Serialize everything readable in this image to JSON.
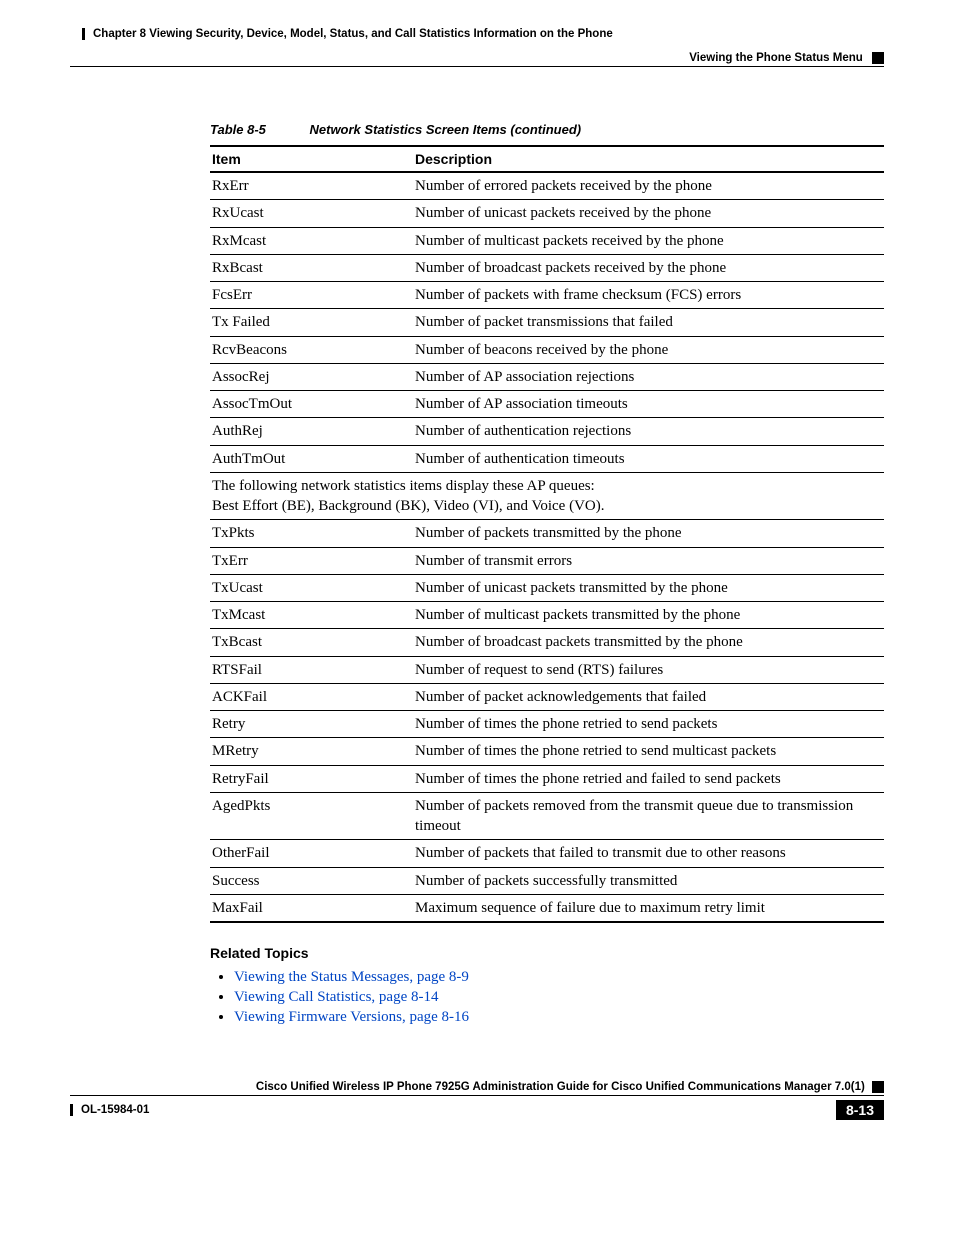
{
  "header": {
    "chapter": "Chapter 8    Viewing Security, Device, Model, Status, and Call Statistics Information on the Phone",
    "section": "Viewing the Phone Status Menu"
  },
  "table": {
    "caption_num": "Table 8-5",
    "caption_title": "Network Statistics Screen Items (continued)",
    "headers": {
      "item": "Item",
      "desc": "Description"
    },
    "rows1": [
      {
        "item": "RxErr",
        "desc": "Number of errored packets received by the phone"
      },
      {
        "item": "RxUcast",
        "desc": "Number of unicast packets received by the phone"
      },
      {
        "item": "RxMcast",
        "desc": "Number of multicast packets received by the phone"
      },
      {
        "item": "RxBcast",
        "desc": "Number of broadcast packets received by the phone"
      },
      {
        "item": "FcsErr",
        "desc": "Number of packets with frame checksum (FCS) errors"
      },
      {
        "item": "Tx Failed",
        "desc": "Number of packet transmissions that failed"
      },
      {
        "item": "RcvBeacons",
        "desc": "Number of beacons received by the phone"
      },
      {
        "item": "AssocRej",
        "desc": "Number of AP association rejections"
      },
      {
        "item": "AssocTmOut",
        "desc": "Number of AP association timeouts"
      },
      {
        "item": "AuthRej",
        "desc": "Number of authentication rejections"
      },
      {
        "item": "AuthTmOut",
        "desc": "Number of authentication timeouts"
      }
    ],
    "span_line1": "The following network statistics items display these AP queues:",
    "span_line2": "Best Effort (BE), Background (BK), Video (VI), and Voice (VO).",
    "rows2": [
      {
        "item": "TxPkts",
        "desc": "Number of packets transmitted by the phone"
      },
      {
        "item": "TxErr",
        "desc": "Number of transmit errors"
      },
      {
        "item": "TxUcast",
        "desc": "Number of unicast packets transmitted by the phone"
      },
      {
        "item": "TxMcast",
        "desc": "Number of multicast packets transmitted by the phone"
      },
      {
        "item": "TxBcast",
        "desc": "Number of broadcast packets transmitted by the phone"
      },
      {
        "item": "RTSFail",
        "desc": "Number of request to send (RTS) failures"
      },
      {
        "item": "ACKFail",
        "desc": "Number of packet acknowledgements that failed"
      },
      {
        "item": "Retry",
        "desc": "Number of times the phone retried to send packets"
      },
      {
        "item": "MRetry",
        "desc": "Number of times the phone retried to send multicast packets"
      },
      {
        "item": "RetryFail",
        "desc": "Number of times the phone retried and failed to send packets"
      },
      {
        "item": "AgedPkts",
        "desc": "Number of packets removed from the transmit queue due to transmission timeout"
      },
      {
        "item": "OtherFail",
        "desc": "Number of packets that failed to transmit due to other reasons"
      },
      {
        "item": "Success",
        "desc": "Number of packets successfully transmitted"
      },
      {
        "item": "MaxFail",
        "desc": "Maximum sequence of failure due to maximum retry limit"
      }
    ]
  },
  "related": {
    "heading": "Related Topics",
    "items": [
      "Viewing the Status Messages, page 8-9",
      "Viewing Call Statistics, page 8-14",
      "Viewing Firmware Versions, page 8-16"
    ]
  },
  "footer": {
    "book": "Cisco Unified Wireless IP Phone 7925G Administration Guide for Cisco Unified Communications Manager 7.0(1)",
    "doc": "OL-15984-01",
    "page": "8-13"
  }
}
